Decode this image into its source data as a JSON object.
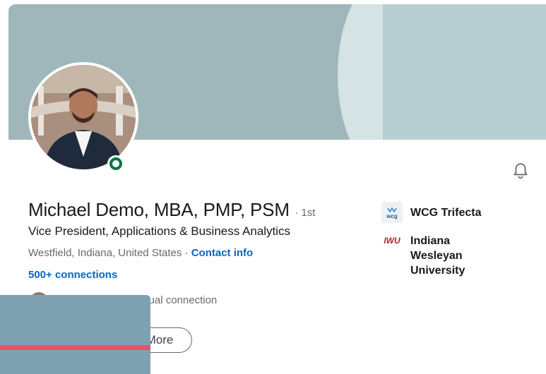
{
  "profile": {
    "name": "Michael Demo, MBA, PMP, PSM",
    "degree": "· 1st",
    "headline": "Vice President, Applications & Business Analytics",
    "location": "Westfield, Indiana, United States",
    "location_separator": " · ",
    "contact_info_label": "Contact info",
    "connections_label": "500+ connections",
    "mutual_connection_text": "utual connection",
    "more_button_label": "More"
  },
  "companies": [
    {
      "logo_text": "wcg",
      "name": "WCG Trifecta"
    },
    {
      "logo_text": "IWU",
      "name": "Indiana Wesleyan\nUniversity"
    }
  ],
  "icons": {
    "bell": "bell-icon",
    "status": "online-status-icon"
  },
  "colors": {
    "banner": "#9fb7ba",
    "link": "#0a66c2",
    "online": "#057642"
  }
}
